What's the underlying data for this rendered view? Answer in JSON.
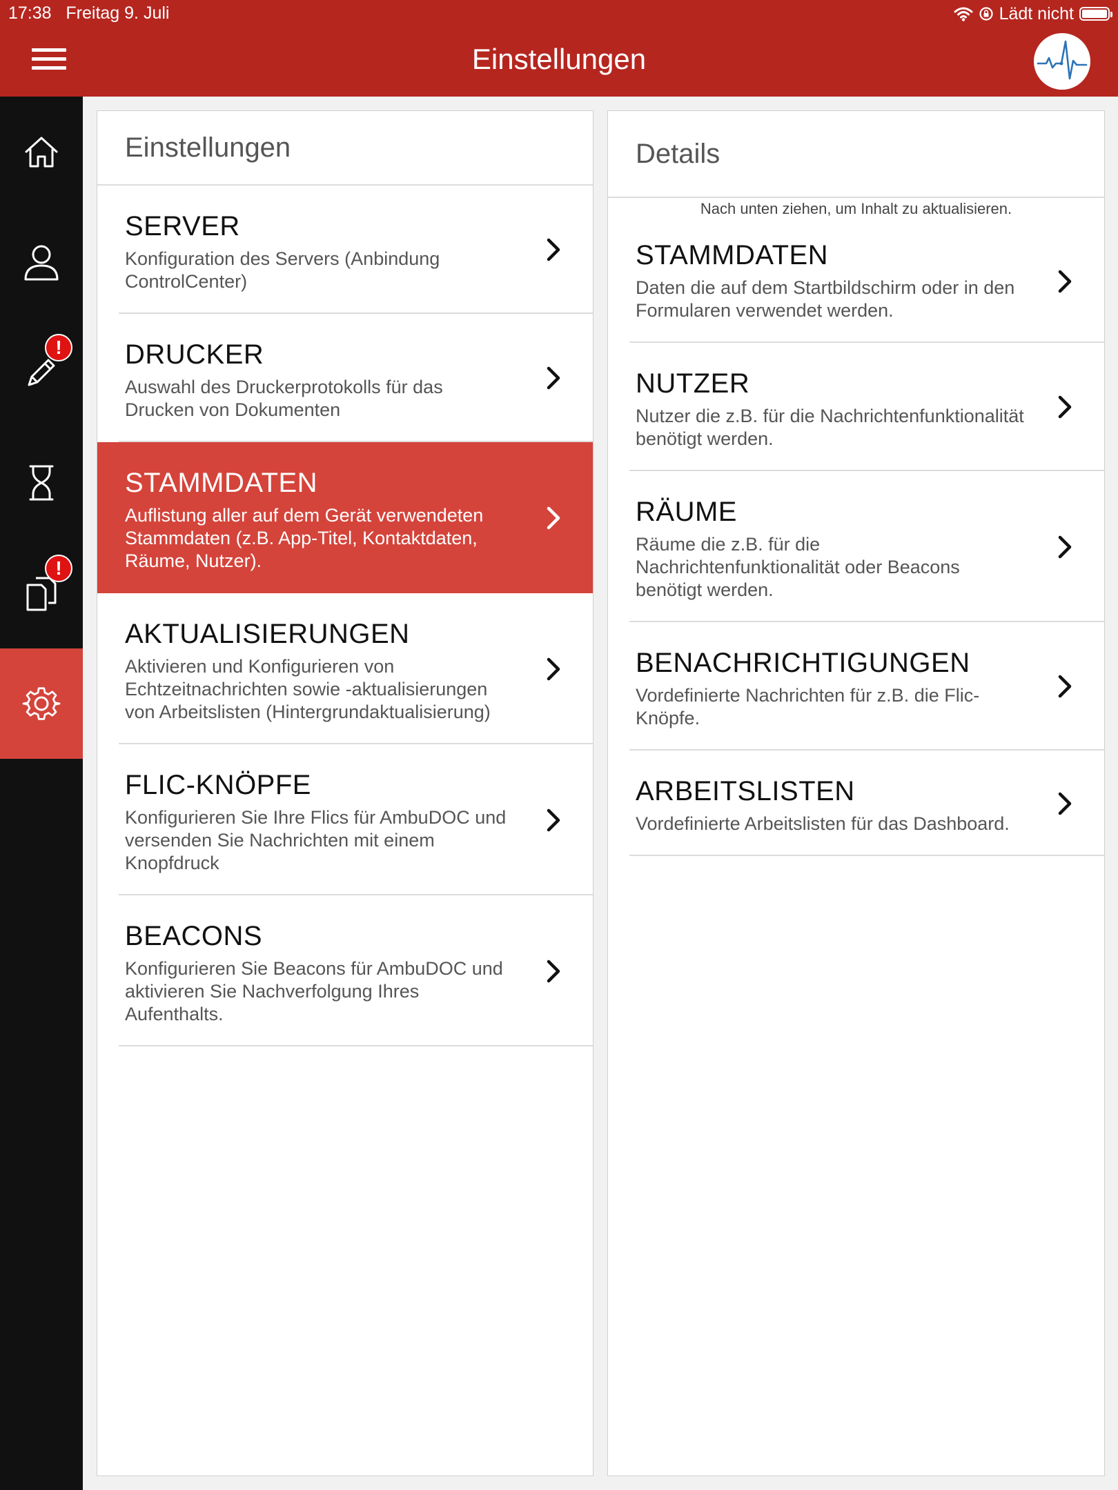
{
  "status_bar": {
    "time_date": "17:38   Freitag 9. Juli",
    "charging_text": "Lädt nicht"
  },
  "header": {
    "title": "Einstellungen",
    "accent_color": "#b5261f",
    "highlight_color": "#d4443b"
  },
  "sidenav": {
    "items": [
      {
        "icon": "home-icon",
        "badge": ""
      },
      {
        "icon": "user-icon",
        "badge": ""
      },
      {
        "icon": "pencil-icon",
        "badge": "!"
      },
      {
        "icon": "hourglass-icon",
        "badge": ""
      },
      {
        "icon": "documents-icon",
        "badge": "!"
      },
      {
        "icon": "gear-icon",
        "badge": "",
        "active": true
      }
    ]
  },
  "left_panel": {
    "title": "Einstellungen",
    "items": [
      {
        "title": "SERVER",
        "desc": "Konfiguration des Servers (Anbindung ControlCenter)"
      },
      {
        "title": "DRUCKER",
        "desc": "Auswahl des Druckerprotokolls für das Drucken von Dokumenten"
      },
      {
        "title": "STAMMDATEN",
        "desc": "Auflistung aller auf dem Gerät verwendeten Stammdaten (z.B. App-Titel, Kontaktdaten, Räume, Nutzer).",
        "selected": true
      },
      {
        "title": "AKTUALISIERUNGEN",
        "desc": "Aktivieren und Konfigurieren von Echtzeitnachrichten sowie -aktualisierungen von Arbeitslisten (Hintergrundaktualisierung)"
      },
      {
        "title": "FLIC-KNÖPFE",
        "desc": "Konfigurieren Sie Ihre Flics für AmbuDOC und versenden Sie Nachrichten mit einem Knopfdruck"
      },
      {
        "title": "BEACONS",
        "desc": "Konfigurieren Sie Beacons für AmbuDOC und aktivieren Sie Nachverfolgung Ihres Aufenthalts."
      }
    ]
  },
  "right_panel": {
    "title": "Details",
    "pull_hint": "Nach unten ziehen, um Inhalt zu aktualisieren.",
    "items": [
      {
        "title": "STAMMDATEN",
        "desc": "Daten die auf dem Startbildschirm oder in den Formularen verwendet werden."
      },
      {
        "title": "NUTZER",
        "desc": "Nutzer die z.B. für die Nachrichtenfunktionalität benötigt werden."
      },
      {
        "title": "RÄUME",
        "desc": "Räume die z.B. für die Nachrichtenfunktionalität oder Beacons benötigt werden."
      },
      {
        "title": "BENACHRICHTIGUNGEN",
        "desc": "Vordefinierte Nachrichten für z.B. die Flic-Knöpfe."
      },
      {
        "title": "ARBEITSLISTEN",
        "desc": "Vordefinierte Arbeitslisten für das Dashboard."
      }
    ]
  }
}
